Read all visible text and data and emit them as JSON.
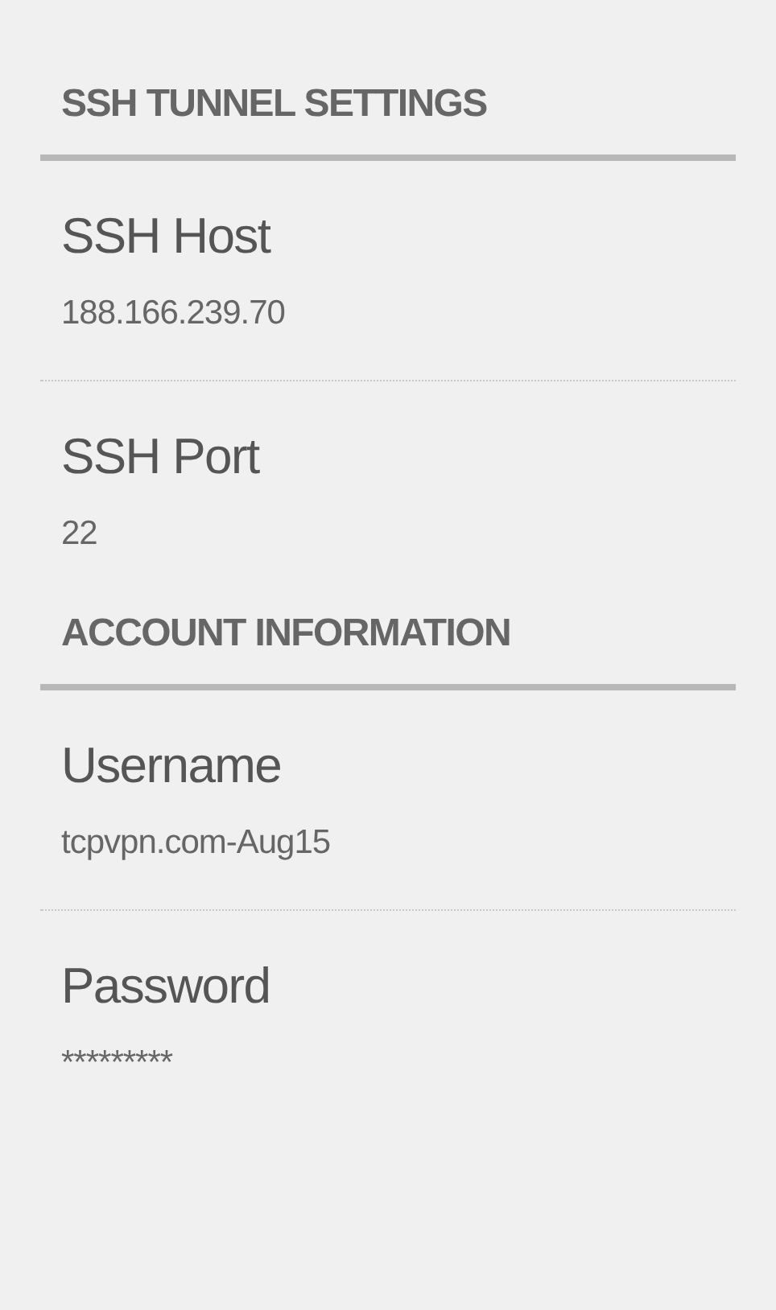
{
  "sections": [
    {
      "heading": "SSH TUNNEL SETTINGS",
      "items": [
        {
          "label": "SSH Host",
          "value": "188.166.239.70"
        },
        {
          "label": "SSH Port",
          "value": "22"
        }
      ]
    },
    {
      "heading": "ACCOUNT INFORMATION",
      "items": [
        {
          "label": "Username",
          "value": "tcpvpn.com-Aug15"
        },
        {
          "label": "Password",
          "value": "*********"
        }
      ]
    }
  ]
}
